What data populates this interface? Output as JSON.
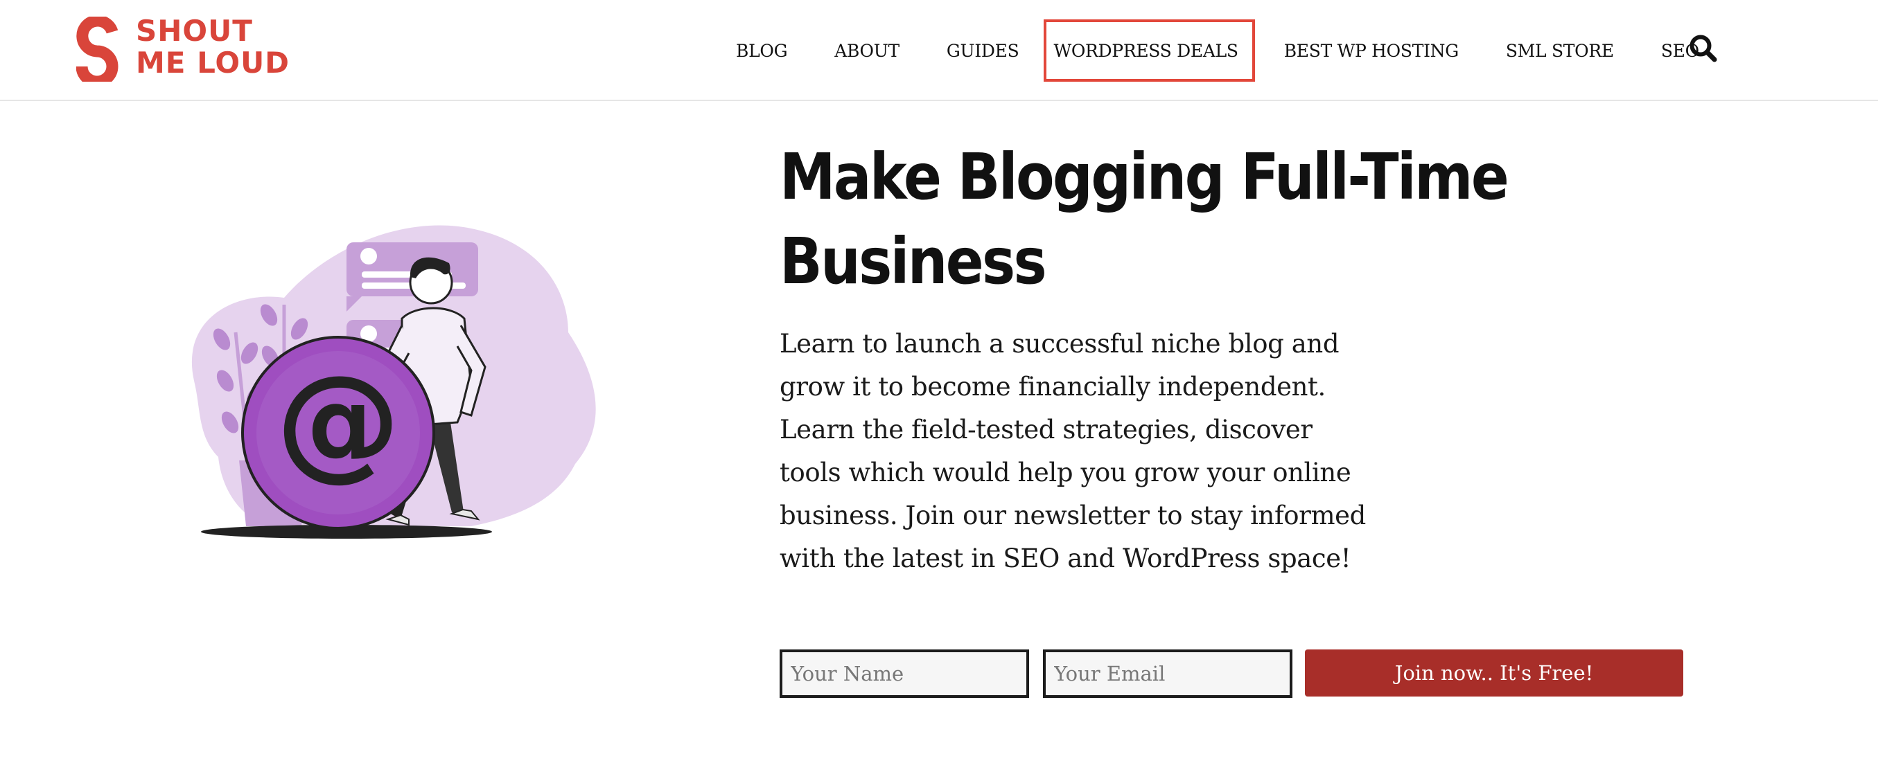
{
  "brand": {
    "line1": "SHOUT",
    "line2": "ME LOUD",
    "color": "#d9453a"
  },
  "nav": {
    "items": [
      {
        "label": "BLOG"
      },
      {
        "label": "ABOUT"
      },
      {
        "label": "GUIDES"
      },
      {
        "label": "WORDPRESS DEALS",
        "highlighted": true
      },
      {
        "label": "BEST WP HOSTING"
      },
      {
        "label": "SML STORE"
      },
      {
        "label": "SEO"
      }
    ],
    "search_icon": "search-icon",
    "highlight_color": "#e2473a"
  },
  "hero": {
    "title": "Make Blogging Full-Time Business",
    "description": "Learn to launch a successful niche blog and grow it to become financially independent. Learn the field-tested strategies, discover tools which would help you grow your online business. Join our newsletter to stay informed with the latest in SEO and WordPress space!"
  },
  "form": {
    "name_placeholder": "Your Name",
    "email_placeholder": "Your Email",
    "submit_label": "Join now.. It's Free!",
    "button_color": "#a82e29"
  },
  "illustration": {
    "icon": "at-sign-icon",
    "accent_color": "#9f4ec0"
  }
}
